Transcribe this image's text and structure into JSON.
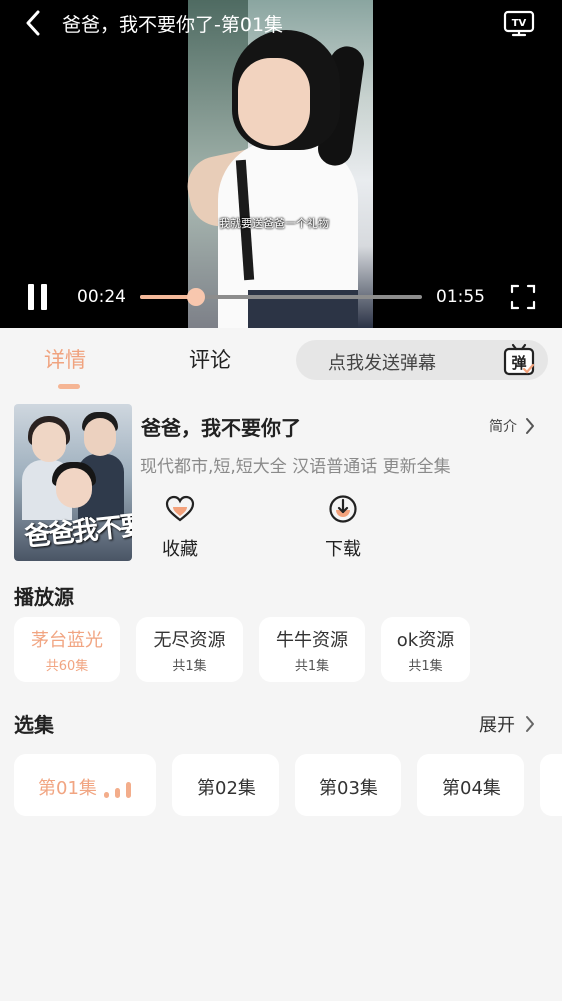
{
  "player": {
    "title": "爸爸，我不要你了-第01集",
    "subtitle": "我就要送爸爸一个礼物",
    "current_time": "00:24",
    "total_time": "01:55",
    "progress": 0.2,
    "icons": {
      "back": "back-arrow-icon",
      "tv": "tv-cast-icon",
      "pause": "pause-icon",
      "fullscreen": "fullscreen-icon"
    }
  },
  "tabs": [
    {
      "label": "详情",
      "active": true
    },
    {
      "label": "评论",
      "active": false
    }
  ],
  "danmaku": {
    "placeholder": "点我发送弹幕",
    "icon_text": "弹"
  },
  "drama": {
    "title": "爸爸，我不要你了",
    "intro_label": "简介",
    "tags": "现代都市,短,短大全 汉语普通话 更新全集",
    "poster_title": "爸爸我不要你了"
  },
  "actions": {
    "favorite_label": "收藏",
    "download_label": "下载"
  },
  "sources": {
    "title": "播放源",
    "items": [
      {
        "name": "茅台蓝光",
        "count": "共60集",
        "active": true
      },
      {
        "name": "无尽资源",
        "count": "共1集",
        "active": false
      },
      {
        "name": "牛牛资源",
        "count": "共1集",
        "active": false
      },
      {
        "name": "ok资源",
        "count": "共1集",
        "active": false
      }
    ]
  },
  "episodes": {
    "title": "选集",
    "expand_label": "展开",
    "items": [
      {
        "label": "第01集",
        "active": true
      },
      {
        "label": "第02集",
        "active": false
      },
      {
        "label": "第03集",
        "active": false
      },
      {
        "label": "第04集",
        "active": false
      }
    ]
  },
  "colors": {
    "accent": "#f0a37f",
    "background": "#f5f5f5",
    "player_bg": "#000000"
  }
}
